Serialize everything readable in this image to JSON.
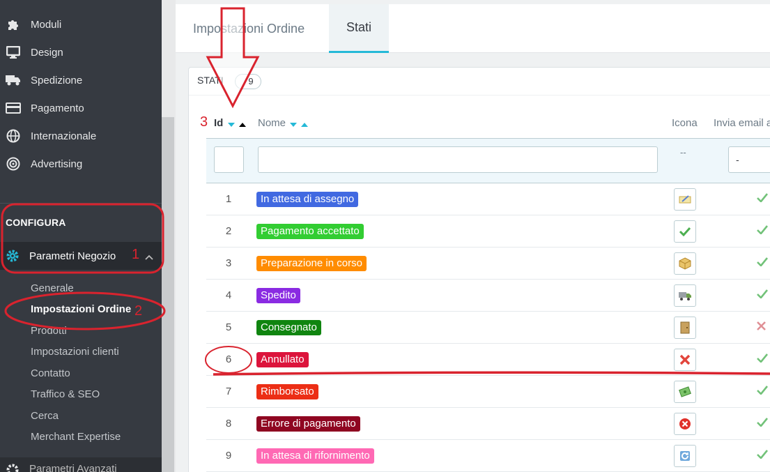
{
  "sidebar": {
    "items": [
      {
        "label": "Moduli",
        "icon": "puzzle-icon"
      },
      {
        "label": "Design",
        "icon": "monitor-icon"
      },
      {
        "label": "Spedizione",
        "icon": "truck-icon"
      },
      {
        "label": "Pagamento",
        "icon": "credit-card-icon"
      },
      {
        "label": "Internazionale",
        "icon": "globe-icon"
      },
      {
        "label": "Advertising",
        "icon": "target-icon"
      }
    ],
    "section": "CONFIGURA",
    "active": {
      "label": "Parametri Negozio",
      "icon": "gear-icon"
    },
    "sub": [
      "Generale",
      "Impostazioni Ordine",
      "Prodotti",
      "Impostazioni clienti",
      "Contatto",
      "Traffico & SEO",
      "Cerca",
      "Merchant Expertise"
    ],
    "bottom": "Parametri Avanzati"
  },
  "tabs": [
    "Impostazioni Ordine",
    "Stati"
  ],
  "panel": {
    "title": "STATI",
    "count": "9"
  },
  "table": {
    "headers": {
      "id": "Id",
      "name": "Nome",
      "icon": "Icona",
      "email": "Invia email a"
    },
    "filters": {
      "icon": "--",
      "email": "-"
    },
    "rows": [
      {
        "id": "1",
        "name": "In attesa di assegno",
        "color": "#4169e1",
        "icon": "cheque-icon",
        "mail": "yes"
      },
      {
        "id": "2",
        "name": "Pagamento accettato",
        "color": "#32cd32",
        "icon": "check-icon",
        "mail": "yes"
      },
      {
        "id": "3",
        "name": "Preparazione in corso",
        "color": "#ff8c00",
        "icon": "package-icon",
        "mail": "yes"
      },
      {
        "id": "4",
        "name": "Spedito",
        "color": "#8a2be2",
        "icon": "truck-icon",
        "mail": "yes"
      },
      {
        "id": "5",
        "name": "Consegnato",
        "color": "#108510",
        "icon": "door-icon",
        "mail": "no"
      },
      {
        "id": "6",
        "name": "Annullato",
        "color": "#dc143c",
        "icon": "cross-icon",
        "mail": "yes"
      },
      {
        "id": "7",
        "name": "Rimborsato",
        "color": "#ec2e15",
        "icon": "money-icon",
        "mail": "yes"
      },
      {
        "id": "8",
        "name": "Errore di pagamento",
        "color": "#8f0621",
        "icon": "error-icon",
        "mail": "yes"
      },
      {
        "id": "9",
        "name": "In attesa di rifornimento",
        "color": "#ff69b4",
        "icon": "refresh-icon",
        "mail": "yes"
      }
    ]
  },
  "annotations": {
    "n1": "1",
    "n2": "2",
    "n3": "3"
  },
  "colors": {
    "accent": "#25b9d7",
    "sidebar": "#363a41",
    "annotation": "#d9232e",
    "check": "#72c279",
    "cross": "#e08f95"
  }
}
